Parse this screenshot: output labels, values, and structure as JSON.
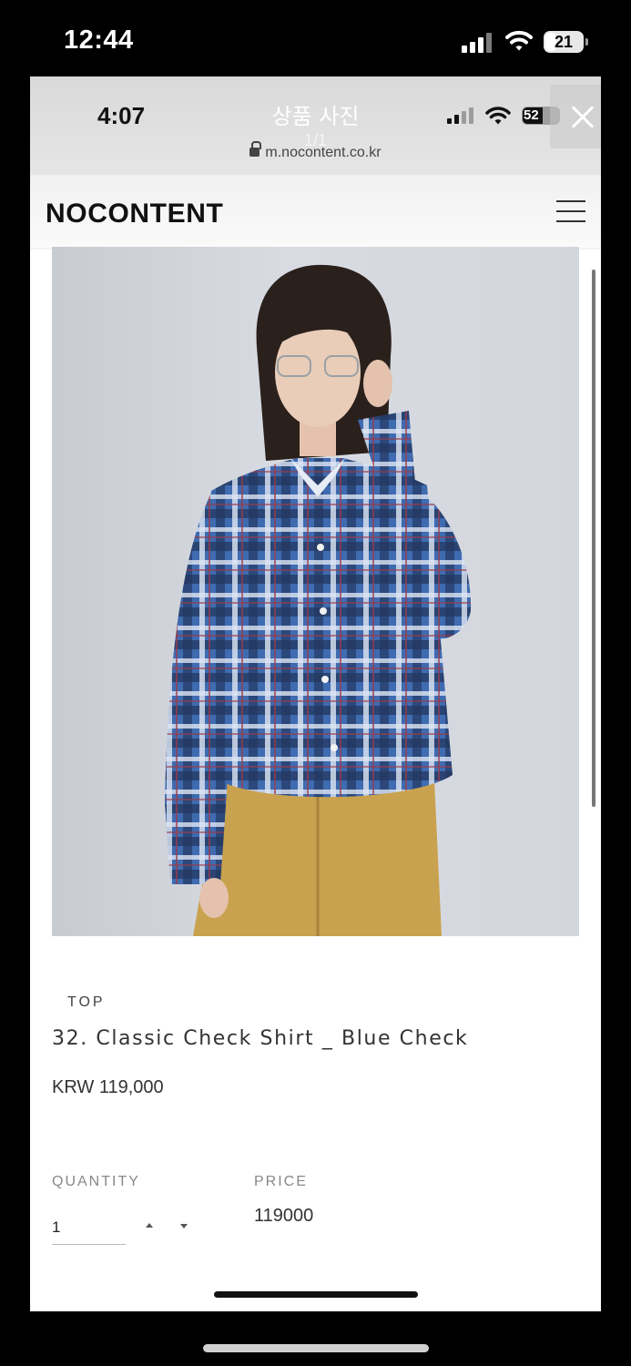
{
  "outer_status": {
    "time": "12:44",
    "battery": "21",
    "icons": [
      "cellular-signal-icon",
      "wifi-icon",
      "battery-icon"
    ]
  },
  "viewer": {
    "title": "상품 사진",
    "count": "1/1",
    "close_icon": "close-icon"
  },
  "inner_status": {
    "time": "4:07",
    "battery": "52",
    "url": "m.nocontent.co.kr"
  },
  "site": {
    "logo": "NOCONTENT",
    "menu_icon": "hamburger-menu-icon"
  },
  "product": {
    "category": "TOP",
    "name": "32. Classic Check Shirt _ Blue Check",
    "price": "KRW 119,000",
    "image_desc": "product-photo",
    "colors": {
      "shirt": "#3f6bb0",
      "skirt": "#c9a24f",
      "background": "#d3d7dd"
    }
  },
  "order": {
    "quantity_label": "QUANTITY",
    "quantity_value": "1",
    "price_label": "PRICE",
    "price_value": "119000"
  }
}
